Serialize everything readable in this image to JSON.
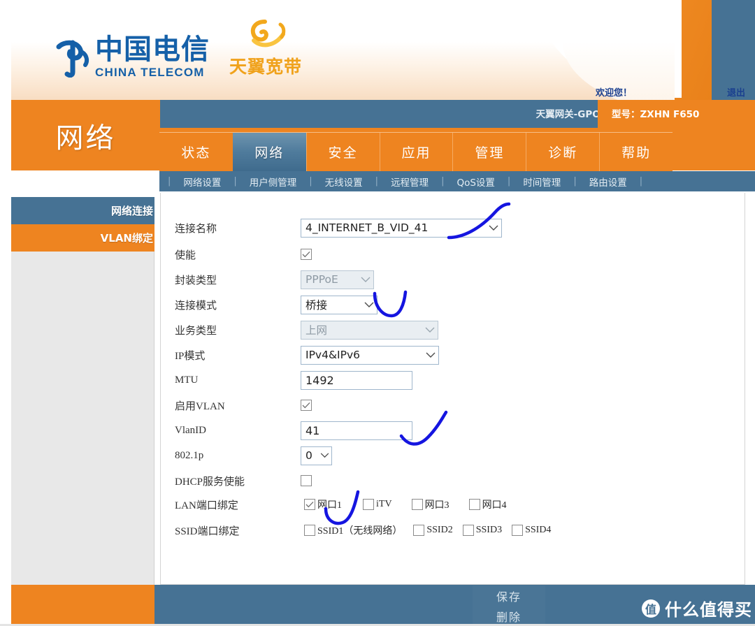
{
  "header": {
    "brand_cn": "中国电信",
    "brand_en": "CHINA TELECOM",
    "sub_brand_cn": "天翼宽带",
    "welcome": "欢迎您！",
    "logout": "退出"
  },
  "titlebar": {
    "section_title": "网络",
    "device_name": "天翼网关-GPON",
    "device_model": "型号：ZXHN F650"
  },
  "tabs": [
    {
      "label": "状态",
      "active": false
    },
    {
      "label": "网络",
      "active": true
    },
    {
      "label": "安全",
      "active": false
    },
    {
      "label": "应用",
      "active": false
    },
    {
      "label": "管理",
      "active": false
    },
    {
      "label": "诊断",
      "active": false
    },
    {
      "label": "帮助",
      "active": false
    }
  ],
  "subnav": [
    {
      "label": "网络设置"
    },
    {
      "label": "用户侧管理"
    },
    {
      "label": "无线设置"
    },
    {
      "label": "远程管理"
    },
    {
      "label": "QoS设置"
    },
    {
      "label": "时间管理"
    },
    {
      "label": "路由设置"
    }
  ],
  "sidebar": {
    "items": [
      {
        "label": "网络连接",
        "active": true
      },
      {
        "label": "VLAN绑定",
        "active": false
      }
    ]
  },
  "form": {
    "conn_name": {
      "label": "连接名称",
      "value": "4_INTERNET_B_VID_41",
      "type": "select"
    },
    "enable": {
      "label": "使能",
      "checked": true
    },
    "encap": {
      "label": "封装类型",
      "value": "PPPoE",
      "type": "select",
      "disabled": true
    },
    "conn_mode": {
      "label": "连接模式",
      "value": "桥接",
      "type": "select",
      "disabled": false
    },
    "svc_type": {
      "label": "业务类型",
      "value": "上网",
      "type": "select",
      "disabled": true
    },
    "ip_mode": {
      "label": "IP模式",
      "value": "IPv4&IPv6",
      "type": "select",
      "disabled": false
    },
    "mtu": {
      "label": "MTU",
      "value": "1492",
      "type": "text"
    },
    "vlan_en": {
      "label": "启用VLAN",
      "checked": true
    },
    "vlan_id": {
      "label": "VlanID",
      "value": "41",
      "type": "text"
    },
    "dot1p": {
      "label": "802.1p",
      "value": "0",
      "type": "select",
      "disabled": false
    },
    "dhcp_en": {
      "label": "DHCP服务使能",
      "checked": false
    },
    "lan_bind": {
      "label": "LAN端口绑定",
      "options": [
        {
          "label": "网口1",
          "checked": true
        },
        {
          "label": "iTV",
          "checked": false
        },
        {
          "label": "网口3",
          "checked": false
        },
        {
          "label": "网口4",
          "checked": false
        }
      ]
    },
    "ssid_bind": {
      "label": "SSID端口绑定",
      "options": [
        {
          "label": "SSID1（无线网络）",
          "checked": false
        },
        {
          "label": "SSID2",
          "checked": false
        },
        {
          "label": "SSID3",
          "checked": false
        },
        {
          "label": "SSID4",
          "checked": false
        }
      ]
    }
  },
  "footer": {
    "save": "保存",
    "delete": "删除",
    "watermark_badge": "值",
    "watermark_text": "什么值得买"
  },
  "colors": {
    "orange": "#ee8420",
    "blue": "#467294",
    "annotation": "#1515e0",
    "panel_bg": "#ffffff",
    "sidebar_bg": "#e8e8e8"
  }
}
